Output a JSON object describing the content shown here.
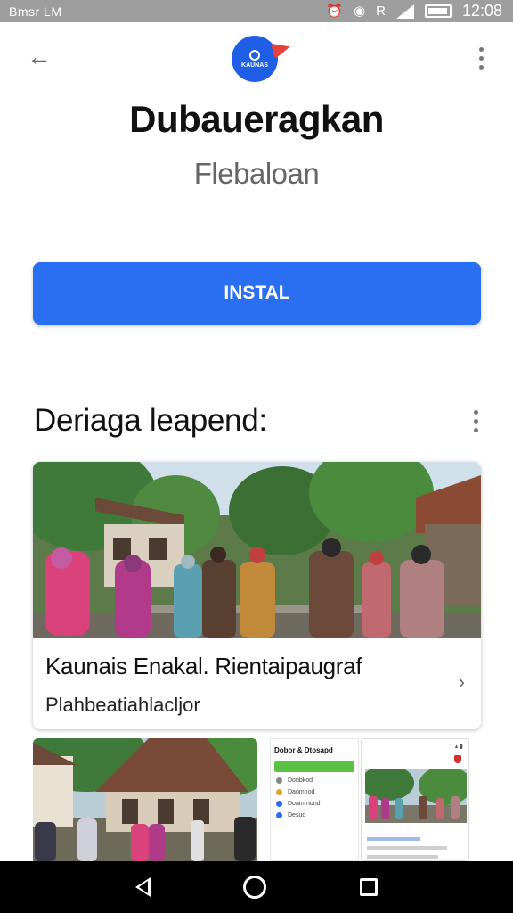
{
  "status_bar": {
    "left_text": "Bmsr LM",
    "time": "12:08",
    "icons": [
      "alarm-icon",
      "wifi-icon",
      "data-icon",
      "signal-icon",
      "battery-icon"
    ],
    "data_label": "R"
  },
  "header": {
    "back_icon": "arrow-left-icon",
    "menu_icon": "more-vert-icon",
    "logo_text": "KAUNAS",
    "app_title": "Dubaueragkan",
    "app_subtitle": "Flebaloan"
  },
  "install": {
    "label": "INSTAL",
    "color": "#2a6ef1"
  },
  "section": {
    "title": "Deriaga leapend:"
  },
  "card": {
    "title": "Kaunais Enakal. Rientaipaugraf",
    "subtitle": "Plahbeatiahlacljor"
  },
  "gallery": {
    "screenshot2": {
      "heading": "Dobor & Dtosapd",
      "rows": [
        "Donbkod",
        "Daomnod",
        "Doamrnond",
        "Desuo"
      ]
    }
  },
  "navbar": {
    "icons": [
      "back-triangle-icon",
      "home-circle-icon",
      "recent-square-icon"
    ]
  },
  "colors": {
    "accent": "#2a6ef1",
    "logo": "#1e5fe6",
    "logo_badge": "#e8403a",
    "status_bar": "#9e9e9e"
  }
}
